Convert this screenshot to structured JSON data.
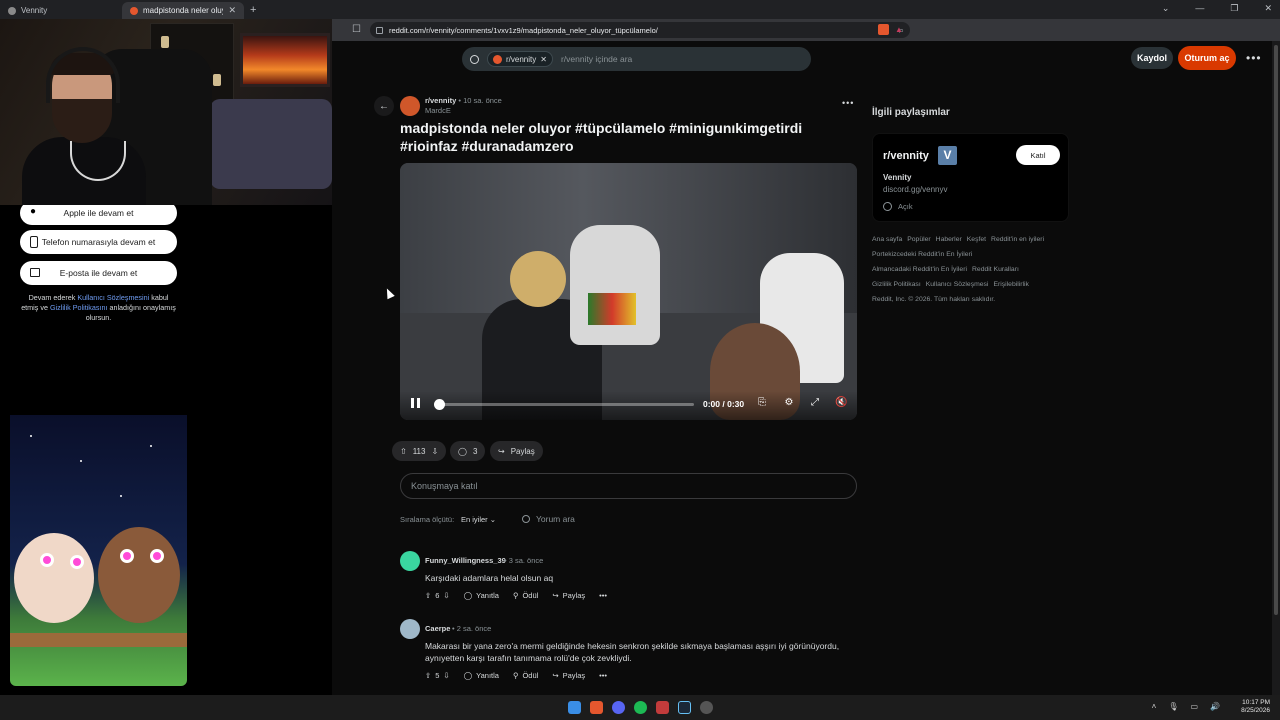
{
  "browser": {
    "tabs": [
      {
        "label": "Vennity"
      },
      {
        "label": "madpistonda neler oluyor #tüpc"
      }
    ],
    "url": "reddit.com/r/vennity/comments/1vxv1z9/madpistonda_neler_oluyor_tüpcülamelo/"
  },
  "reddit": {
    "search": {
      "scope_chip": "r/vennity",
      "placeholder": "r/vennity içinde ara"
    },
    "header": {
      "signup_label": "Kaydol",
      "login_label": "Oturum aç"
    },
    "login_panel": {
      "apple": "Apple ile devam et",
      "phone": "Telefon numarasıyla devam et",
      "email": "E-posta ile devam et",
      "legal_prefix": "Devam ederek ",
      "legal_terms": "Kullanıcı Sözleşmesini",
      "legal_mid1": " kabul etmiş ve ",
      "legal_privacy": "Gizlilik Politikasını",
      "legal_suffix": " anladığını onaylamış olursun."
    },
    "post": {
      "subreddit": "r/vennity",
      "time": "10 sa. önce",
      "author": "MardcE",
      "title": "madpistonda neler oluyor #tüpcülamelo #minigunıkimgetirdi #rioinfaz #duranadamzero",
      "video": {
        "time": "0:00 / 0:30",
        "progress": 0
      },
      "votes": "113",
      "comments": "3",
      "share_label": "Paylaş"
    },
    "comment_box_placeholder": "Konuşmaya katıl",
    "sort": {
      "label": "Sıralama ölçütü:",
      "value": "En iyiler",
      "search_placeholder": "Yorum ara"
    },
    "comments": [
      {
        "author": "Funny_Willingness_39",
        "time": "3 sa. önce",
        "body": "Karşıdaki adamlara helal olsun aq",
        "votes": "6",
        "reply": "Yanıtla",
        "award": "Ödül",
        "share": "Paylaş",
        "avatar_color": "#3ad6a0"
      },
      {
        "author": "Caerpe",
        "time": "2 sa. önce",
        "body": "Makarası bir yana zero'a mermi geldiğinde hekesin senkron şekilde sıkmaya başlaması aşşırı iyi görünüyordu, aynıyetten karşı tarafın tanımama rolü'de çok zevkliydi.",
        "votes": "5",
        "reply": "Yanıtla",
        "award": "Ödül",
        "share": "Paylaş",
        "avatar_color": "#9fb8c9"
      }
    ],
    "sidebar": {
      "related_title": "İlgili paylaşımlar",
      "card": {
        "name": "r/vennity",
        "badge": "V",
        "join_label": "Katıl",
        "title": "Vennity",
        "link": "discord.gg/vennyv",
        "status": "Açık"
      },
      "footer_links": [
        "Ana sayfa",
        "Popüler",
        "Haberler",
        "Keşfet",
        "Reddit'in en iyileri",
        "Portekizcedeki Reddit'in En İyileri",
        "Almancadaki Reddit'in En İyileri",
        "Reddit Kuralları",
        "Gizlilik Politikası",
        "Kullanıcı Sözleşmesi",
        "Erişilebilirlik",
        "Reddit, Inc. © 2026. Tüm hakları saklıdır."
      ]
    }
  },
  "taskbar": {
    "time": "10:17 PM",
    "date": "8/25/2026"
  },
  "colors": {
    "accent": "#d93900",
    "background": "#0b0b0b",
    "link": "#6f9cf2"
  }
}
